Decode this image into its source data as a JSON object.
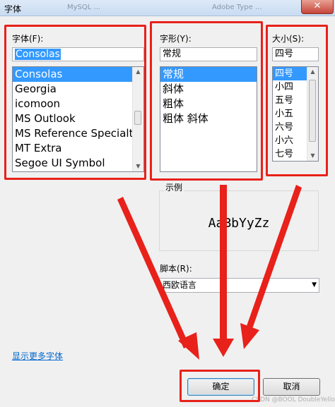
{
  "window": {
    "title": "字体",
    "bg_text_1": "MySQL ...",
    "bg_text_2": "Adobe Type ...",
    "close_glyph": "✕"
  },
  "font": {
    "label": "字体(F):",
    "value": "Consolas",
    "items": [
      "Consolas",
      "Georgia",
      "icomoon",
      "MS Outlook",
      "MS Reference Specialt",
      "MT Extra",
      "Segoe UI Symbol"
    ],
    "selected_index": 0
  },
  "style": {
    "label": "字形(Y):",
    "value": "常规",
    "items": [
      "常规",
      "斜体",
      "粗体",
      "粗体 斜体"
    ],
    "selected_index": 0
  },
  "size": {
    "label": "大小(S):",
    "value": "四号",
    "items": [
      "四号",
      "小四",
      "五号",
      "小五",
      "六号",
      "小六",
      "七号"
    ],
    "selected_index": 0
  },
  "sample": {
    "label": "示例",
    "text": "AaBbYyZz"
  },
  "script": {
    "label": "脚本(R):",
    "selected": "西欧语言"
  },
  "more_fonts_link": "显示更多字体",
  "buttons": {
    "ok": "确定",
    "cancel": "取消"
  },
  "watermark": "CSDN @BOOL DoubleYellow",
  "annotation_color": "#e8211a"
}
